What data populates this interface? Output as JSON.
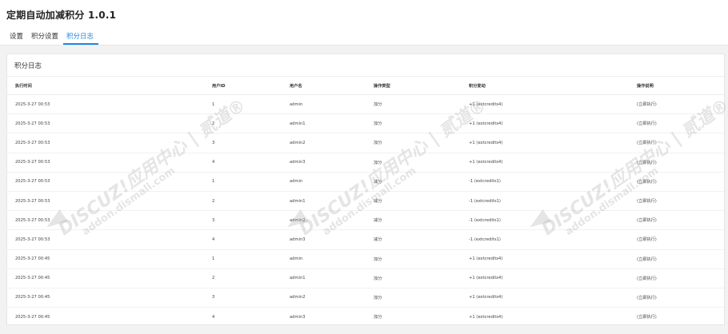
{
  "app": {
    "title": "定期自动加减积分 1.0.1"
  },
  "tabs": [
    {
      "label": "设置",
      "active": false
    },
    {
      "label": "积分设置",
      "active": false
    },
    {
      "label": "积分日志",
      "active": true
    }
  ],
  "accent_color": "#1e88e5",
  "panel": {
    "title": "积分日志"
  },
  "table": {
    "columns": [
      "执行时间",
      "用户ID",
      "用户名",
      "操作类型",
      "积分变动",
      "操作说明"
    ],
    "rows": [
      [
        "2025-3-27 00:53",
        "1",
        "admin",
        "加分",
        "+1 (extcredits4)",
        "(立即执行)"
      ],
      [
        "2025-3-27 00:53",
        "2",
        "admin1",
        "加分",
        "+1 (extcredits4)",
        "(立即执行)"
      ],
      [
        "2025-3-27 00:53",
        "3",
        "admin2",
        "加分",
        "+1 (extcredits4)",
        "(立即执行)"
      ],
      [
        "2025-3-27 00:53",
        "4",
        "admin3",
        "加分",
        "+1 (extcredits4)",
        "(立即执行)"
      ],
      [
        "2025-3-27 00:53",
        "1",
        "admin",
        "减分",
        "-1 (extcredits1)",
        "(立即执行)"
      ],
      [
        "2025-3-27 00:53",
        "2",
        "admin1",
        "减分",
        "-1 (extcredits1)",
        "(立即执行)"
      ],
      [
        "2025-3-27 00:53",
        "3",
        "admin2",
        "减分",
        "-1 (extcredits1)",
        "(立即执行)"
      ],
      [
        "2025-3-27 00:53",
        "4",
        "admin3",
        "减分",
        "-1 (extcredits1)",
        "(立即执行)"
      ],
      [
        "2025-3-27 00:45",
        "1",
        "admin",
        "加分",
        "+1 (extcredits4)",
        "(立即执行)"
      ],
      [
        "2025-3-27 00:45",
        "2",
        "admin1",
        "加分",
        "+1 (extcredits4)",
        "(立即执行)"
      ],
      [
        "2025-3-27 00:45",
        "3",
        "admin2",
        "加分",
        "+1 (extcredits4)",
        "(立即执行)"
      ],
      [
        "2025-3-27 00:45",
        "4",
        "admin3",
        "加分",
        "+1 (extcredits4)",
        "(立即执行)"
      ]
    ]
  },
  "watermark": {
    "line1": "DISCUZ!应用中心 | 贰道®",
    "line2": "addon.dismall.com"
  }
}
